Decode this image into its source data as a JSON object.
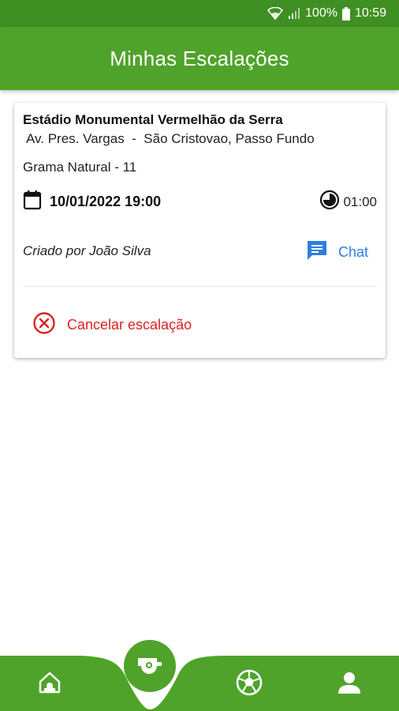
{
  "status_bar": {
    "battery": "100%",
    "time": "10:59",
    "icons": [
      "wifi-icon",
      "signal-icon",
      "battery-icon"
    ]
  },
  "app_bar": {
    "title": "Minhas Escalações"
  },
  "booking": {
    "venue_name": "Estádio Monumental Vermelhão da Serra",
    "address": "Av. Pres. Vargas  -  São Cristovao, Passo Fundo",
    "field_type": "Grama Natural - 11",
    "datetime": "10/01/2022 19:00",
    "duration": "01:00",
    "creator": "Criado por João Silva",
    "chat_label": "Chat",
    "cancel_label": "Cancelar escalação"
  },
  "bottom_nav": {
    "items": [
      "home-icon",
      "whistle-icon",
      "soccer-ball-icon",
      "profile-icon"
    ],
    "active": "whistle-icon"
  },
  "colors": {
    "status_bar": "#3f8f22",
    "primary": "#4fa32a",
    "chat": "#2d7fe0",
    "cancel": "#e02020"
  }
}
